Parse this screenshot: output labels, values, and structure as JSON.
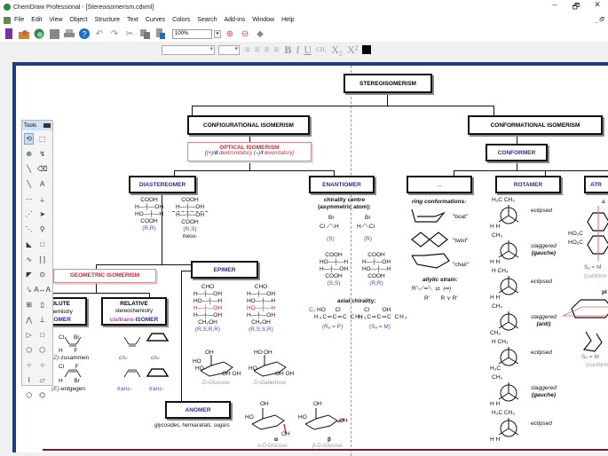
{
  "window": {
    "title": "ChemDraw Professional - [Stereoisomerism.cdxml]",
    "controls": {
      "minimize": "–",
      "restore": "🗗",
      "close": "✕"
    }
  },
  "menu": [
    "File",
    "Edit",
    "View",
    "Object",
    "Structure",
    "Text",
    "Curves",
    "Colors",
    "Search",
    "Add-ins",
    "Window",
    "Help"
  ],
  "toolbar": {
    "icons": [
      "new-document-icon",
      "open-icon",
      "open-web-icon",
      "save-icon",
      "print-icon",
      "help-icon",
      "undo-icon",
      "redo-icon",
      "cut-icon",
      "copy-icon",
      "paste-icon"
    ],
    "zoom_value": "100%",
    "zoom_icons": [
      "zoom-in-icon",
      "zoom-out-icon",
      "fit-icon"
    ]
  },
  "format_toolbar": {
    "font_value": "",
    "size_value": "",
    "buttons": [
      "B",
      "I",
      "U",
      "CH₂",
      "X₂",
      "X²"
    ]
  },
  "tools_palette": {
    "title": "Tools",
    "items": [
      "lasso",
      "marquee",
      "mass-fragment",
      "structure-perspective",
      "bond",
      "eraser",
      "bold-bond",
      "text",
      "dashed-bond",
      "chain",
      "hashed-bond",
      "arrow",
      "hollow-wedge",
      "orbital",
      "wedge-bond",
      "drawing-element",
      "wavy-bond",
      "bracket",
      "hashed-wedge",
      "chemical-symbol",
      "bond-atom-attach",
      "acyclic-chain",
      "table",
      "template",
      "stereo",
      "stamp",
      "triangle",
      "rectangle",
      "cyclopentane",
      "cyclohexane",
      "cycloheptane",
      "cyclooctane",
      "cyclohexane-chair-1",
      "cyclohexane-chair-2",
      "cyclopentadiene",
      "benzene"
    ]
  },
  "diagram": {
    "root": "STEREOISOMERISM",
    "configurational": "CONFIGURATIONAL ISOMERISM",
    "conformational": "CONFORMATIONAL ISOMERISM",
    "optical": {
      "title": "OPTICAL ISOMERISM",
      "sub_a": "[(+)/",
      "sub_d": "d",
      "sub_b": " dextrorotatory ",
      "sub_c": "(–)/",
      "sub_l": "l",
      "sub_e": " levorotatory]"
    },
    "conformer": "CONFORMER",
    "diastereomer": "DIASTEREOMER",
    "enantiomer": "ENANTIOMER",
    "ellipsis": "...",
    "rotamer": "ROTAMER",
    "atropisomer": "ATR",
    "geometric": "GEOMETRIC ISOMERISM",
    "absolute": {
      "l1": "OLUTE",
      "l2": "chemistry",
      "l3": "SOMER"
    },
    "relative": {
      "l1": "RELATIVE",
      "l2": "stereochemistry",
      "l3a": "cis/trans-",
      "l3b": "ISOMER"
    },
    "epimer": "EPIMER",
    "anomer": "ANOMER",
    "anomer_note": "glycosides, hemiacetals, sugars",
    "diast_rr": {
      "top": "COOH",
      "r1": "H—┼—OH",
      "r2": "HO—┼—H",
      "bot": "COOH",
      "label": "(R,R)"
    },
    "diast_rs": {
      "top": "COOH",
      "r1": "H—┼—OH",
      "r2": "H—┼—OH",
      "bot": "COOH",
      "label": "(R,S)",
      "note": "meso-"
    },
    "chirality_centre": {
      "l1": "chirality centre",
      "l2": "(asymmetric atom):"
    },
    "enant_s": "(S)",
    "enant_r": "(R)",
    "enant_ss": {
      "top": "COOH",
      "r1": "HO—┼—H",
      "r2": "H—┼—OH",
      "bot": "COOH",
      "label": "(S,S)"
    },
    "enant_rr": {
      "top": "COOH",
      "r1": "H—┼—OH",
      "r2": "HO—┼—H",
      "bot": "COOH",
      "label": "(R,R)"
    },
    "axial_chirality": "axial chirality:",
    "axial_ra": "(Rₐ = P)",
    "axial_sa": "(Sₐ = M)",
    "epimer_glc": {
      "top": "CHO",
      "rows": [
        "H—┼—OH",
        "HO—┼—H",
        "H—┼—OH",
        "H—┼—OH"
      ],
      "bot": "CH₂OH",
      "label": "(R,S,R,R)",
      "name": "D-Glucose"
    },
    "epimer_gal": {
      "top": "CHO",
      "rows": [
        "H—┼—OH",
        "HO—┼—H",
        "HO—┼—H",
        "H—┼—OH"
      ],
      "bot": "CH₂OH",
      "label": "(R,S,S,R)",
      "name": "D-Galactose"
    },
    "anomer_alpha": {
      "symbol": "α",
      "name": "α-D-Glucose"
    },
    "anomer_beta": {
      "symbol": "β",
      "name": "β-D-Glucose"
    },
    "ring_conformations": "ring conformations:",
    "boat": "\"boat\"",
    "twist": "\"twist\"",
    "chair": "\"chair\"",
    "allylic_strain": "allylic strain:",
    "rotamer_labels": [
      {
        "a": "eclipsed",
        "b": ""
      },
      {
        "a": "staggered",
        "b": "(gauche)"
      },
      {
        "a": "eclipsed",
        "b": ""
      },
      {
        "a": "staggered",
        "b": "(anti)"
      },
      {
        "a": "eclipsed",
        "b": ""
      },
      {
        "a": "staggered",
        "b": "(gauche)"
      },
      {
        "a": "eclipsed",
        "b": ""
      }
    ],
    "atrop_axial": "Sₐ = M",
    "atrop_planar": "Sₚ = M",
    "conform_note": "(conform",
    "z_label": {
      "a": "(Z)",
      "b": "-zusammen"
    },
    "e_label": {
      "a": "(E)",
      "b": "-entgegen"
    },
    "cis": "cis-",
    "trans": "trans-"
  },
  "colors": {
    "frame_blue": "#1a3f7a",
    "accent_red": "#c8283a",
    "label_blue": "#4a4ab0",
    "bottom_rule": "#7a1c2c"
  }
}
